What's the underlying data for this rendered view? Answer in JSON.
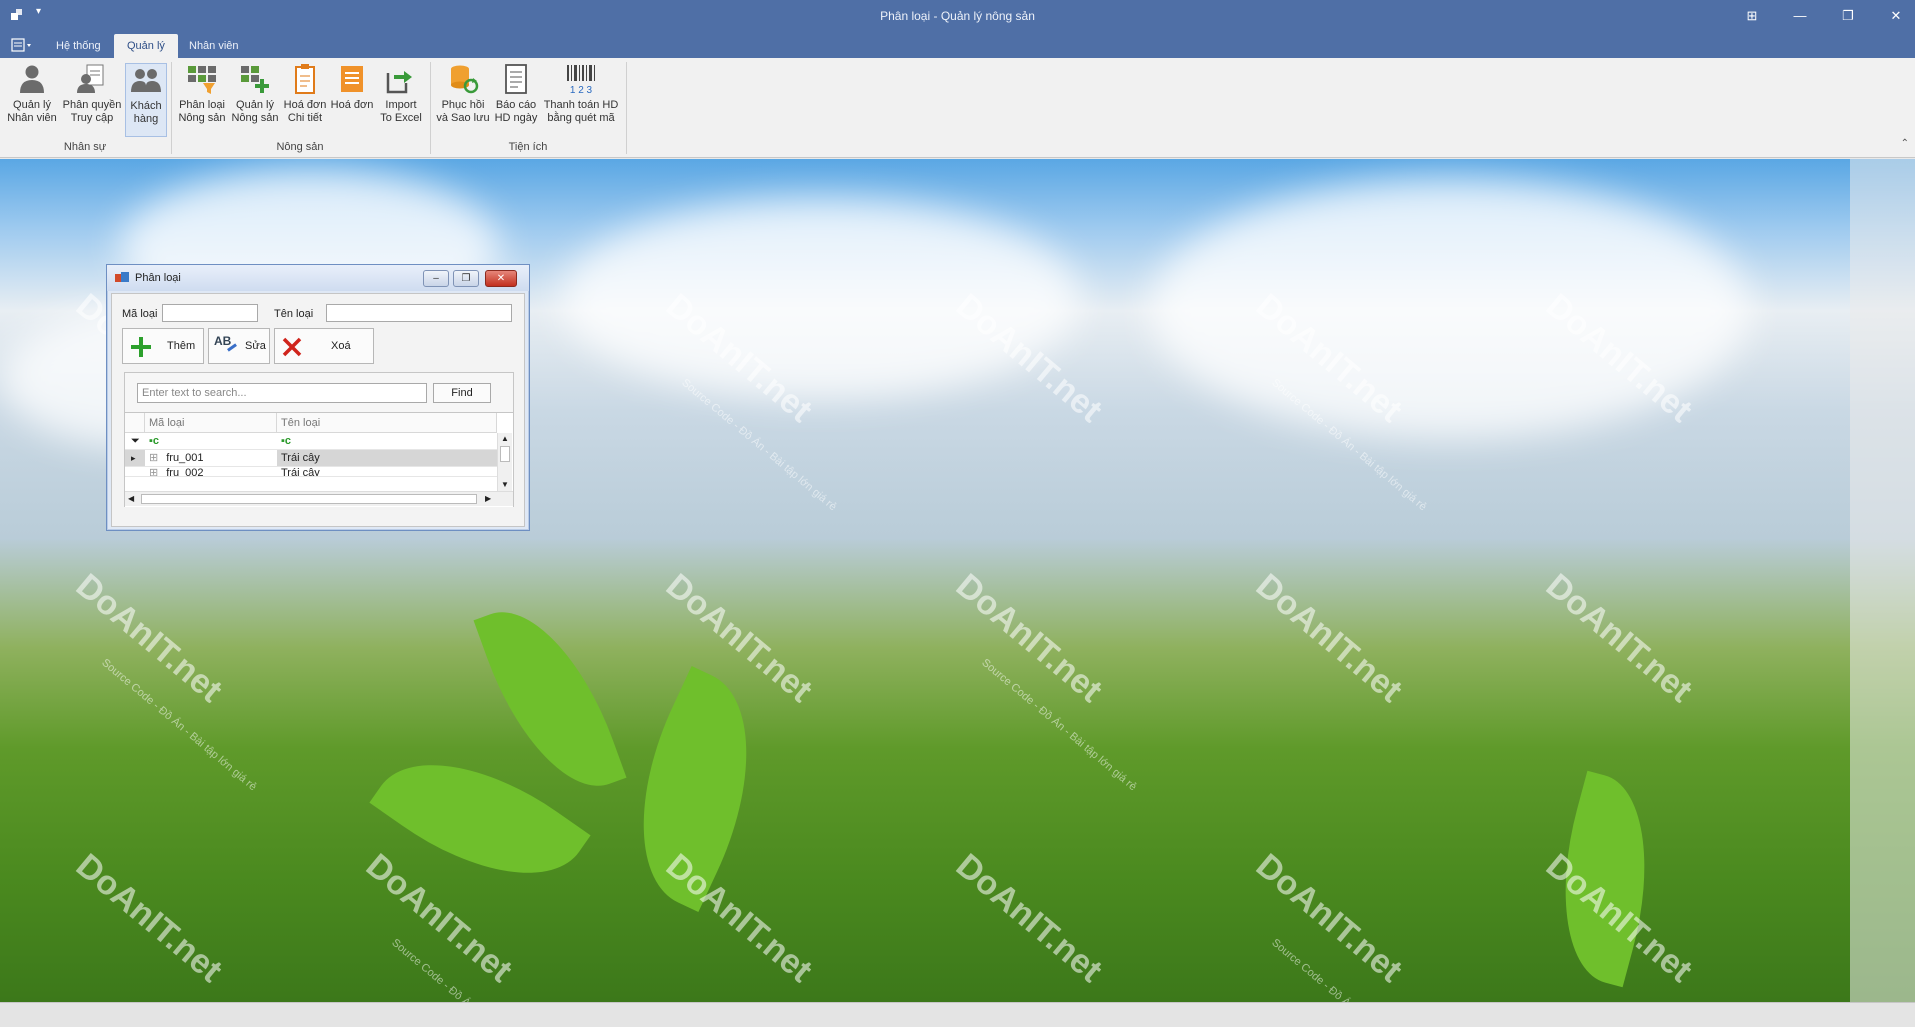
{
  "window": {
    "title": "Phân loại - Quản lý nông sản"
  },
  "tabs": [
    {
      "label": "Hệ thống"
    },
    {
      "label": "Quản lý"
    },
    {
      "label": "Nhân viên"
    }
  ],
  "ribbon": {
    "groups": [
      {
        "label": "Nhân sự"
      },
      {
        "label": "Nông sản"
      },
      {
        "label": "Tiện ích"
      }
    ],
    "buttons": {
      "quan_ly_nhan_vien": {
        "line1": "Quản lý",
        "line2": "Nhân viên"
      },
      "phan_quyen": {
        "line1": "Phân quyền",
        "line2": "Truy cập"
      },
      "khach_hang": {
        "line1": "Khách",
        "line2": "hàng"
      },
      "phan_loai": {
        "line1": "Phân loại",
        "line2": "Nông sản"
      },
      "quan_ly_nong_san": {
        "line1": "Quản lý",
        "line2": "Nông sản"
      },
      "hoa_don_chi_tiet": {
        "line1": "Hoá đơn",
        "line2": "Chi tiết"
      },
      "hoa_don": {
        "line1": "Hoá đơn",
        "line2": ""
      },
      "import_excel": {
        "line1": "Import",
        "line2": "To Excel"
      },
      "phuc_hoi": {
        "line1": "Phục hồi",
        "line2": "và Sao lưu"
      },
      "bao_cao": {
        "line1": "Báo cáo",
        "line2": "HD ngày"
      },
      "thanh_toan": {
        "line1": "Thanh toán HD",
        "line2": "bằng quét mã"
      }
    }
  },
  "child_window": {
    "title": "Phân loại",
    "ma_loai_label": "Mã loại",
    "ma_loai_value": "",
    "ten_loai_label": "Tên loại",
    "ten_loai_value": "",
    "buttons": {
      "them": "Thêm",
      "sua": "Sửa",
      "sua_icon_text": "AB",
      "xoa": "Xoá"
    },
    "search_placeholder": "Enter text to search...",
    "find_label": "Find",
    "grid": {
      "columns": [
        "Mã loại",
        "Tên loại"
      ],
      "rows": [
        {
          "ma_loai": "fru_001",
          "ten_loai": "Trái cây"
        },
        {
          "ma_loai": "fru_002",
          "ten_loai": "Trái cây"
        }
      ]
    }
  },
  "watermark": {
    "brand": "DoAnIT.net",
    "tagline": "Source Code - Đồ Án - Bài tập lớn giá rẻ"
  },
  "colors": {
    "titlebar": "#4f6fa6",
    "ribbon": "#f1f1f1",
    "active_tab_text": "#2f4f87",
    "close_button": "#c2301f"
  }
}
